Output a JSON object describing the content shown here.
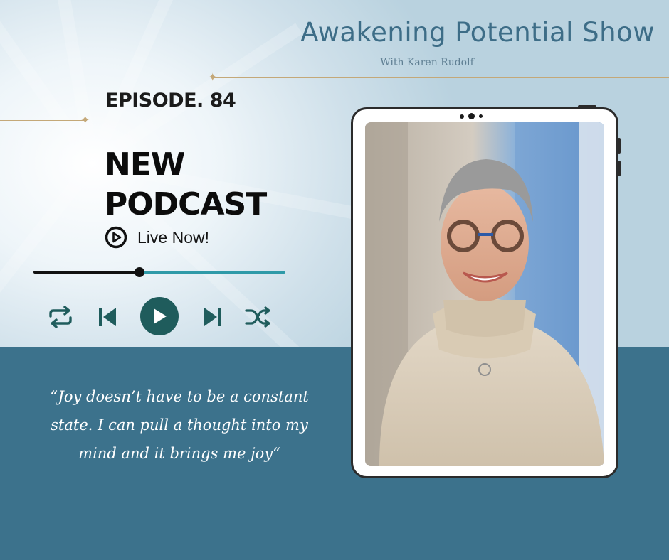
{
  "header": {
    "show_title": "Awakening Potential Show",
    "show_subtitle": "With Karen Rudolf"
  },
  "episode": {
    "label": "EPISODE. 84",
    "headline_line1": "NEW",
    "headline_line2": "PODCAST",
    "live_text": "Live Now!"
  },
  "player": {
    "progress_fraction": 0.42,
    "controls": [
      "repeat-icon",
      "previous-icon",
      "play-icon",
      "next-icon",
      "shuffle-icon"
    ]
  },
  "quote": {
    "line1": "“Joy doesn’t have to be a constant",
    "line2": "state. I can pull a thought into my",
    "line3": "mind and it brings me joy“"
  },
  "colors": {
    "band": "#3c728c",
    "accent_teal": "#2f9aa8",
    "play_button": "#1f5c5c",
    "title_blue": "#3d6d87",
    "gold": "#c4a878"
  }
}
